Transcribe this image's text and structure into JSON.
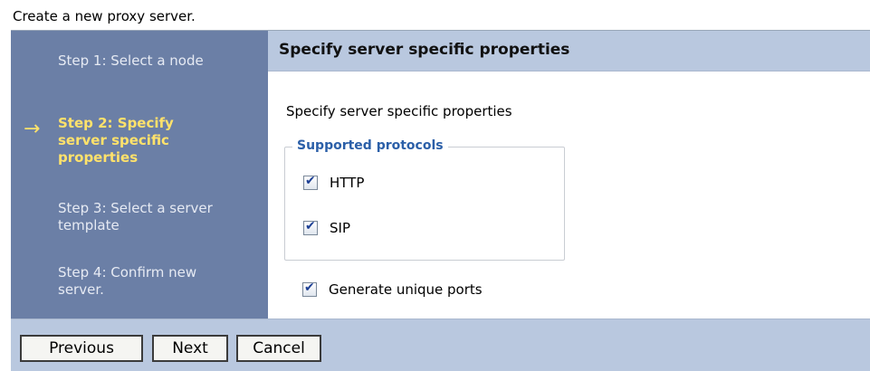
{
  "page": {
    "header": "Create a new proxy server."
  },
  "sidebar": {
    "steps": [
      {
        "label": "Step 1: Select a node"
      },
      {
        "label": "Step 2: Specify server specific properties"
      },
      {
        "label": "Step 3: Select a server template"
      },
      {
        "label": "Step 4: Confirm new server."
      }
    ],
    "current_icon": "right-arrow-icon"
  },
  "main": {
    "title": "Specify server specific properties",
    "description": "Specify server specific properties",
    "protocols": {
      "legend": "Supported protocols",
      "items": [
        {
          "label": "HTTP",
          "checked": true
        },
        {
          "label": "SIP",
          "checked": true
        }
      ]
    },
    "generate_ports": {
      "label": "Generate unique ports",
      "checked": true
    }
  },
  "buttons": {
    "previous": "Previous",
    "next": "Next",
    "cancel": "Cancel"
  },
  "colors": {
    "sidebar_bg": "#6b7fa6",
    "current_step": "#ffe26b",
    "header_bg": "#b9c8df",
    "legend_text": "#2b5fa8"
  }
}
